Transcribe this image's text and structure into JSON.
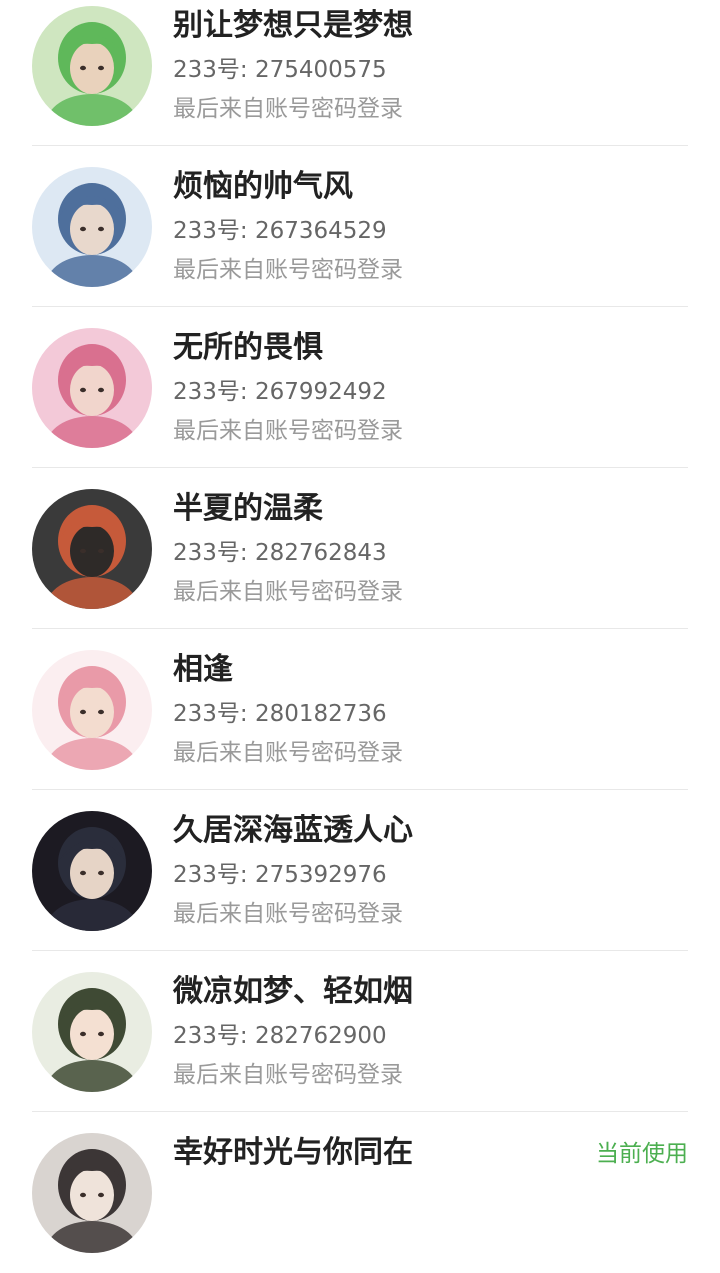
{
  "accounts": [
    {
      "name": "别让梦想只是梦想",
      "uid": "233号: 275400575",
      "login": "最后来自账号密码登录",
      "avatar_icon": "avatar-green-hair-girl",
      "colors": [
        "#cfe6c0",
        "#5fb85a",
        "#e9d2bc"
      ]
    },
    {
      "name": "烦恼的帅气风",
      "uid": "233号: 267364529",
      "login": "最后来自账号密码登录",
      "avatar_icon": "avatar-blue-hair-boy",
      "colors": [
        "#dde8f3",
        "#4e6f9c",
        "#e8d8cc"
      ]
    },
    {
      "name": "无所的畏惧",
      "uid": "233号: 267992492",
      "login": "最后来自账号密码登录",
      "avatar_icon": "avatar-pink-hair-girl",
      "colors": [
        "#f3c9d8",
        "#d9708f",
        "#f1d5cc"
      ]
    },
    {
      "name": "半夏的温柔",
      "uid": "233号: 282762843",
      "login": "最后来自账号密码登录",
      "avatar_icon": "avatar-boy-at-desk",
      "colors": [
        "#3a3a3a",
        "#c65a3a",
        "#2e2a28"
      ]
    },
    {
      "name": "相逢",
      "uid": "233号: 280182736",
      "login": "最后来自账号密码登录",
      "avatar_icon": "avatar-pink-hair-boy",
      "colors": [
        "#fbeef0",
        "#e99aa8",
        "#f3dccf"
      ]
    },
    {
      "name": "久居深海蓝透人心",
      "uid": "233号: 275392976",
      "login": "最后来自账号密码登录",
      "avatar_icon": "avatar-dark-hair-boy",
      "colors": [
        "#1c1a22",
        "#2a2d3b",
        "#e6d4c6"
      ]
    },
    {
      "name": "微凉如梦、轻如烟",
      "uid": "233号: 282762900",
      "login": "最后来自账号密码登录",
      "avatar_icon": "avatar-green-bob-girl",
      "colors": [
        "#e9ede2",
        "#3f4a34",
        "#f4e0d2"
      ]
    },
    {
      "name": "幸好时光与你同在",
      "uid": "",
      "login": "",
      "current_label": "当前使用",
      "avatar_icon": "avatar-dark-hair-girl",
      "colors": [
        "#d9d4d0",
        "#3c3636",
        "#efe3da"
      ]
    }
  ],
  "current_color": "#4caf50"
}
